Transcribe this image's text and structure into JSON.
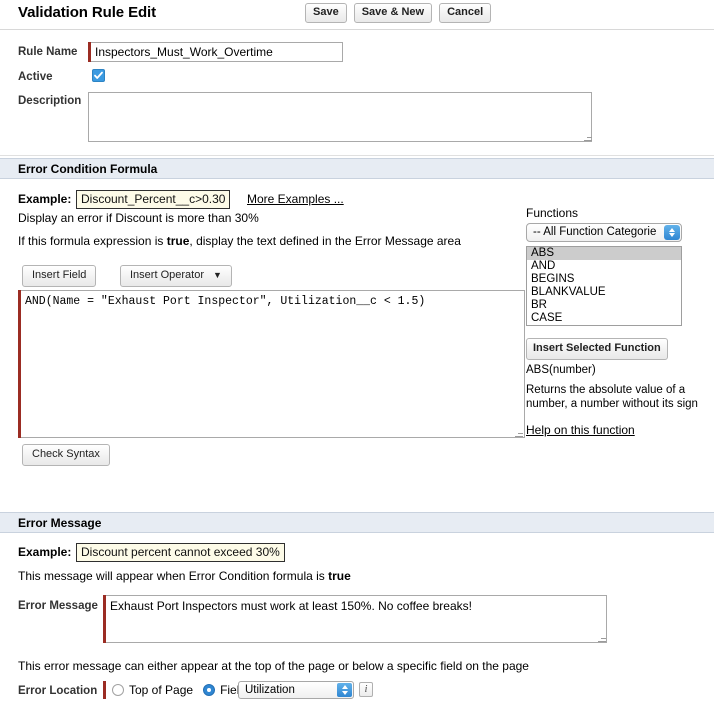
{
  "header": {
    "title": "Validation Rule Edit",
    "buttons": [
      {
        "label": "Save",
        "name": "save-button"
      },
      {
        "label": "Save & New",
        "name": "save-and-new-button"
      },
      {
        "label": "Cancel",
        "name": "cancel-button"
      }
    ]
  },
  "rule": {
    "name_label": "Rule Name",
    "name_value": "Inspectors_Must_Work_Overtime",
    "active_label": "Active",
    "active_checked": true,
    "description_label": "Description",
    "description_value": ""
  },
  "formula_section": {
    "section_title": "Error Condition Formula",
    "example_label": "Example:",
    "example_value": "Discount_Percent__c>0.30",
    "more_examples_link": "More Examples ...",
    "example_caption": "Display an error if Discount is more than 30%",
    "true_sentence_pre": "If this formula expression is ",
    "true_sentence_bold": "true",
    "true_sentence_post": ", display the text defined in the Error Message area",
    "insert_field_button": "Insert Field",
    "insert_operator_button": "Insert Operator",
    "insert_operator_caret": "▼",
    "formula_value": "AND(Name = \"Exhaust Port Inspector\", Utilization__c < 1.5)",
    "check_syntax_button": "Check Syntax"
  },
  "functions_panel": {
    "label": "Functions",
    "category_selected": "-- All Function Categorie",
    "items": [
      "ABS",
      "AND",
      "BEGINS",
      "BLANKVALUE",
      "BR",
      "CASE"
    ],
    "selected_item": "ABS",
    "insert_button": "Insert Selected Function",
    "signature": "ABS(number)",
    "description": "Returns the absolute value of a number, a number without its sign",
    "help_link": "Help on this function"
  },
  "error_message_section": {
    "section_title": "Error Message",
    "example_label": "Example:",
    "example_value": "Discount percent cannot exceed 30%",
    "appear_sentence_pre": "This message will appear when Error Condition formula is ",
    "appear_sentence_bold": "true",
    "message_label": "Error Message",
    "message_value": "Exhaust Port Inspectors must work at least 150%. No coffee breaks!",
    "location_hint": "This error message can either appear at the top of the page or below a specific field on the page",
    "location_label": "Error Location",
    "radio_top_label": "Top of Page",
    "radio_field_label": "Field",
    "selected_location": "Field",
    "field_selected": "Utilization",
    "info_glyph": "i"
  },
  "colors": {
    "section_header_bg": "#e7ecf3",
    "required_bar": "#9b2c23",
    "accent_blue": "#2f86d2",
    "example_bg": "#fdfbe8",
    "listbox_selected_bg": "#cccccc"
  }
}
